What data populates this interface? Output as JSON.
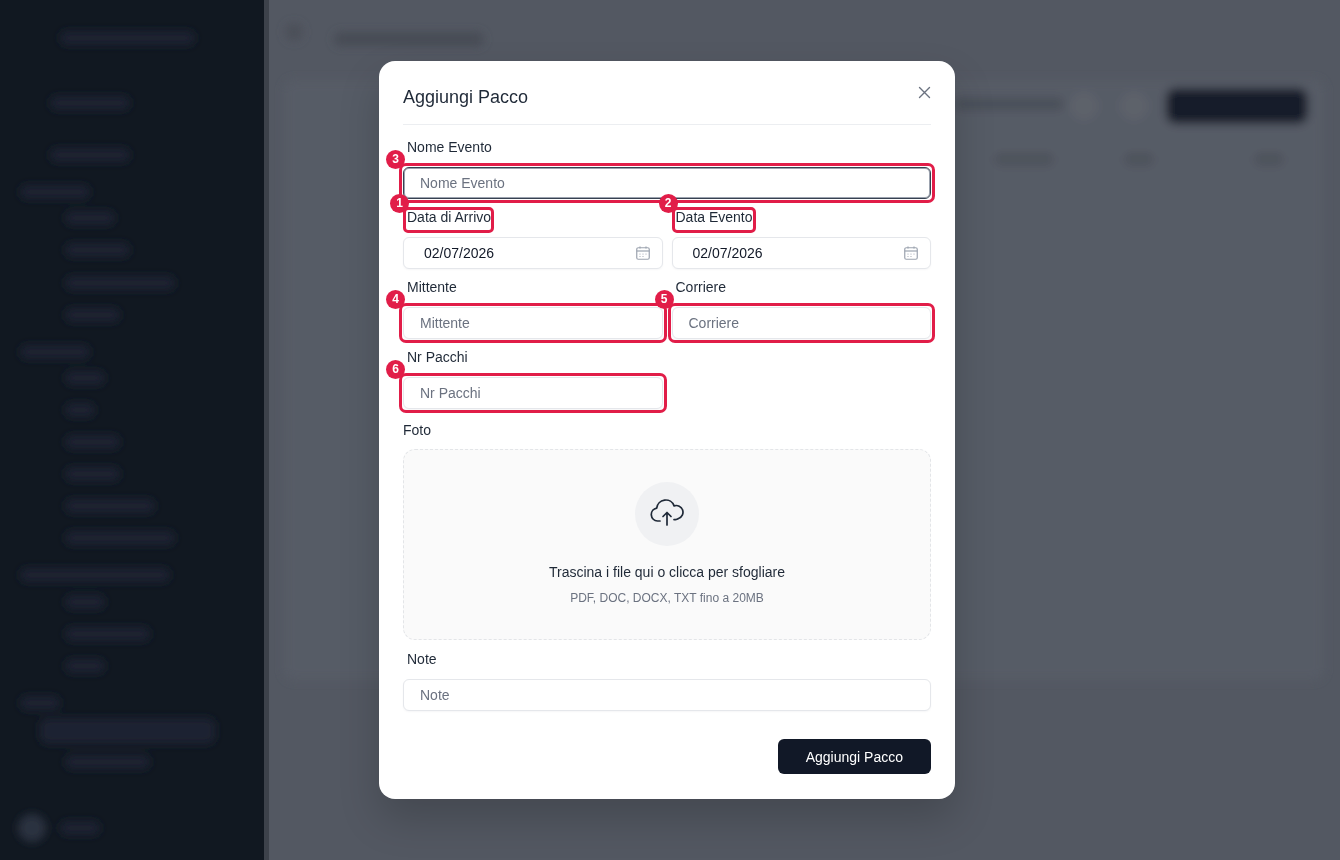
{
  "dialog": {
    "title": "Aggiungi Pacco",
    "name_field": {
      "kind": "text",
      "label": "Nome Evento",
      "placeholder": "Nome Evento",
      "focused": true,
      "input_annotation": "3"
    },
    "grid_fields": [
      {
        "kind": "date",
        "label": "Data di Arrivo",
        "label_annotation": "1",
        "value": "02/07/2026",
        "focused": false
      },
      {
        "kind": "date",
        "label": "Data Evento",
        "label_annotation": "2",
        "value": "02/07/2026",
        "focused": false
      },
      {
        "kind": "text",
        "label": "Mittente",
        "placeholder": "Mittente",
        "focused": false,
        "input_annotation": "4"
      },
      {
        "kind": "text",
        "label": "Corriere",
        "placeholder": "Corriere",
        "focused": false,
        "input_annotation": "5"
      },
      {
        "kind": "text",
        "label": "Nr Pacchi",
        "placeholder": "Nr Pacchi",
        "focused": false,
        "input_annotation": "6"
      }
    ],
    "photo": {
      "label": "Foto",
      "prompt": "Trascina i file qui o clicca per sfogliare",
      "hint": "PDF, DOC, DOCX, TXT fino a 20MB"
    },
    "note_field": {
      "kind": "text",
      "label": "Note",
      "placeholder": "Note",
      "focused": false
    },
    "submit_button": "Aggiungi Pacco"
  }
}
